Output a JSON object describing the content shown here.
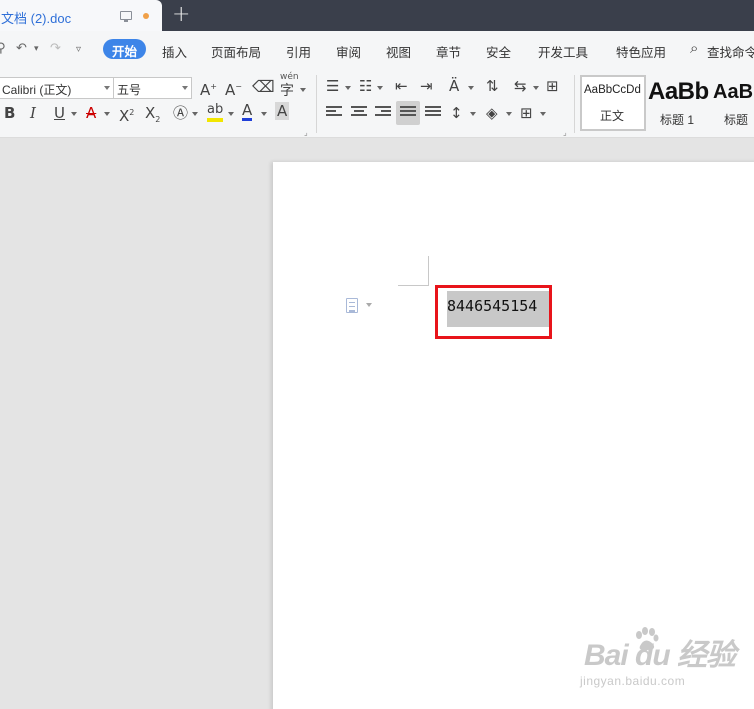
{
  "app": {
    "tab_title": "文档 (2).doc"
  },
  "menu": {
    "items": [
      {
        "label": "开始",
        "active": true
      },
      {
        "label": "插入"
      },
      {
        "label": "页面布局"
      },
      {
        "label": "引用"
      },
      {
        "label": "审阅"
      },
      {
        "label": "视图"
      },
      {
        "label": "章节"
      },
      {
        "label": "安全"
      },
      {
        "label": "开发工具"
      },
      {
        "label": "特色应用"
      }
    ],
    "search_label": "查找命令"
  },
  "ribbon": {
    "font_name": "Calibri (正文)",
    "font_size": "五号",
    "phonetic_label": "wén",
    "styles": [
      {
        "sample": "AaBbCcDd",
        "name": "正文"
      },
      {
        "sample": "AaBb",
        "name": "标题 1"
      },
      {
        "sample": "AaB",
        "name": "标题"
      }
    ]
  },
  "document": {
    "selected_text": "8446545154"
  },
  "watermark": {
    "logo": "Bai du 经验",
    "url": "jingyan.baidu.com"
  },
  "colors": {
    "accent": "#3d85e8",
    "highlight_box": "#e8141a",
    "titlebar": "#3a3f4b",
    "selection": "#c8c8c8"
  }
}
